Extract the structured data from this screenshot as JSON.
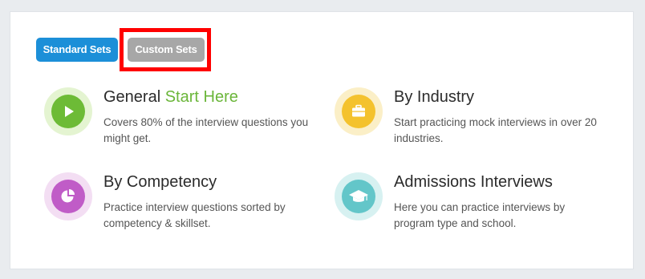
{
  "tabs": {
    "standard_label": "Standard Sets",
    "custom_label": "Custom Sets"
  },
  "items": [
    {
      "title": "General",
      "title_accent": "Start Here",
      "description": "Covers 80% of the interview questions you might get.",
      "icon": "play-icon"
    },
    {
      "title": "By Industry",
      "description": "Start practicing mock interviews in over 20 industries.",
      "icon": "briefcase-icon"
    },
    {
      "title": "By Competency",
      "description": "Practice interview questions sorted by competency & skillset.",
      "icon": "pie-chart-icon"
    },
    {
      "title": "Admissions Interviews",
      "description": "Here you can practice interviews by program type and school.",
      "icon": "graduation-cap-icon"
    }
  ],
  "colors": {
    "standard_pill": "#1c8fd8",
    "custom_pill": "#a7a7a7",
    "highlight": "#ff0000",
    "accent_green": "#6bb63a",
    "yellow": "#f4c22d",
    "purple": "#c05cc7",
    "teal": "#63c6c9"
  }
}
